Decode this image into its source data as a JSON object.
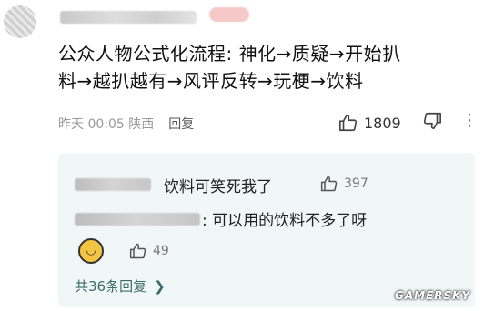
{
  "comment": {
    "text": "公众人物公式化流程: 神化→质疑→开始扒\n料→越扒越有→风评反转→玩梗→饮料",
    "time": "昨天 00:05 陕西",
    "reply_label": "回复",
    "likes": "1809"
  },
  "replies": {
    "items": [
      {
        "text": "饮料可笑死我了",
        "likes": "397"
      },
      {
        "text": ": 可以用的饮料不多了呀"
      },
      {
        "likes": "49"
      }
    ],
    "total_label": "共36条回复"
  },
  "watermark": "GAMERSKY"
}
